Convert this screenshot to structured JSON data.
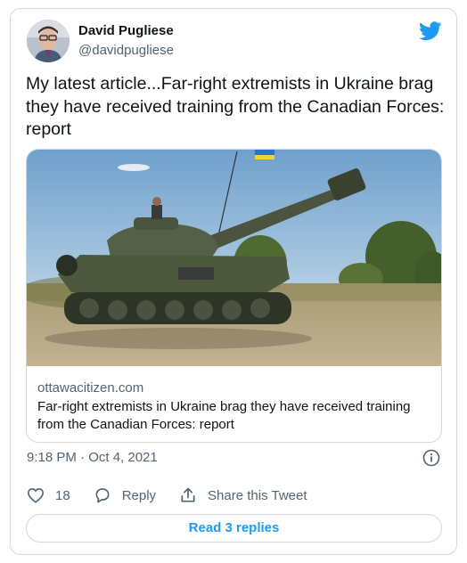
{
  "author": {
    "name": "David Pugliese",
    "handle": "@davidpugliese"
  },
  "tweet": {
    "text": "My latest article...Far-right extremists in Ukraine brag they have received training from the Canadian Forces: report",
    "timestamp": "9:18 PM · Oct 4, 2021"
  },
  "link_card": {
    "domain": "ottawacitizen.com",
    "title": "Far-right extremists in Ukraine brag they have received training from the Canadian Forces: report",
    "image_description_icon": "tank-photo"
  },
  "actions": {
    "like_count": "18",
    "reply_label": "Reply",
    "share_label": "Share this Tweet"
  },
  "replies_button": "Read 3 replies",
  "colors": {
    "brand_blue": "#1d9bf0",
    "secondary_text": "#536471",
    "border": "#cfd9de"
  }
}
